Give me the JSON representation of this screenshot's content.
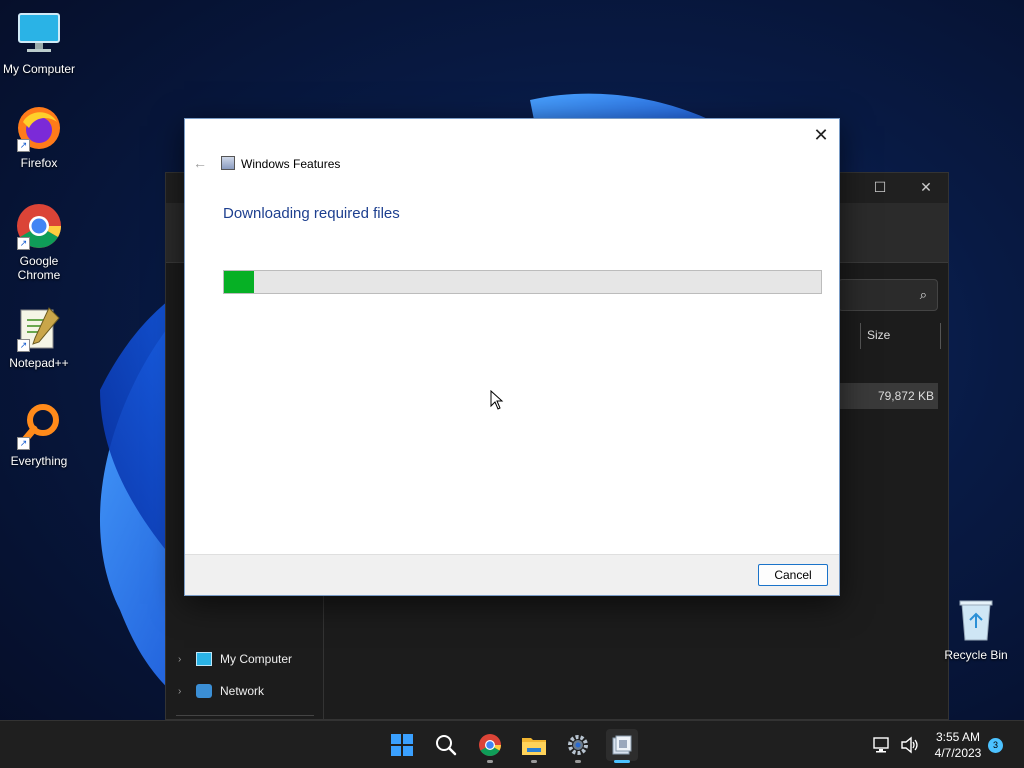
{
  "desktop": {
    "icons": [
      {
        "label": "My Computer"
      },
      {
        "label": "Firefox"
      },
      {
        "label": "Google Chrome"
      },
      {
        "label": "Notepad++"
      },
      {
        "label": "Everything"
      }
    ],
    "recycle_bin": {
      "label": "Recycle Bin"
    }
  },
  "explorer": {
    "column_header": "Size",
    "selected_row_size": "79,872 KB",
    "nav": [
      {
        "label": "My Computer"
      },
      {
        "label": "Network"
      }
    ]
  },
  "dialog": {
    "title": "Windows Features",
    "heading": "Downloading required files",
    "progress_percent": 5,
    "cancel_label": "Cancel",
    "close_glyph": "✕",
    "back_glyph": "←"
  },
  "taskbar": {
    "time": "3:55 AM",
    "date": "4/7/2023",
    "notification_count": "3",
    "apps": [
      "start",
      "search",
      "chrome",
      "file-explorer",
      "settings",
      "windows-features"
    ]
  },
  "colors": {
    "progress_fill": "#06b025",
    "accent": "#4cc2ff",
    "dialog_heading": "#1d3f8f"
  }
}
